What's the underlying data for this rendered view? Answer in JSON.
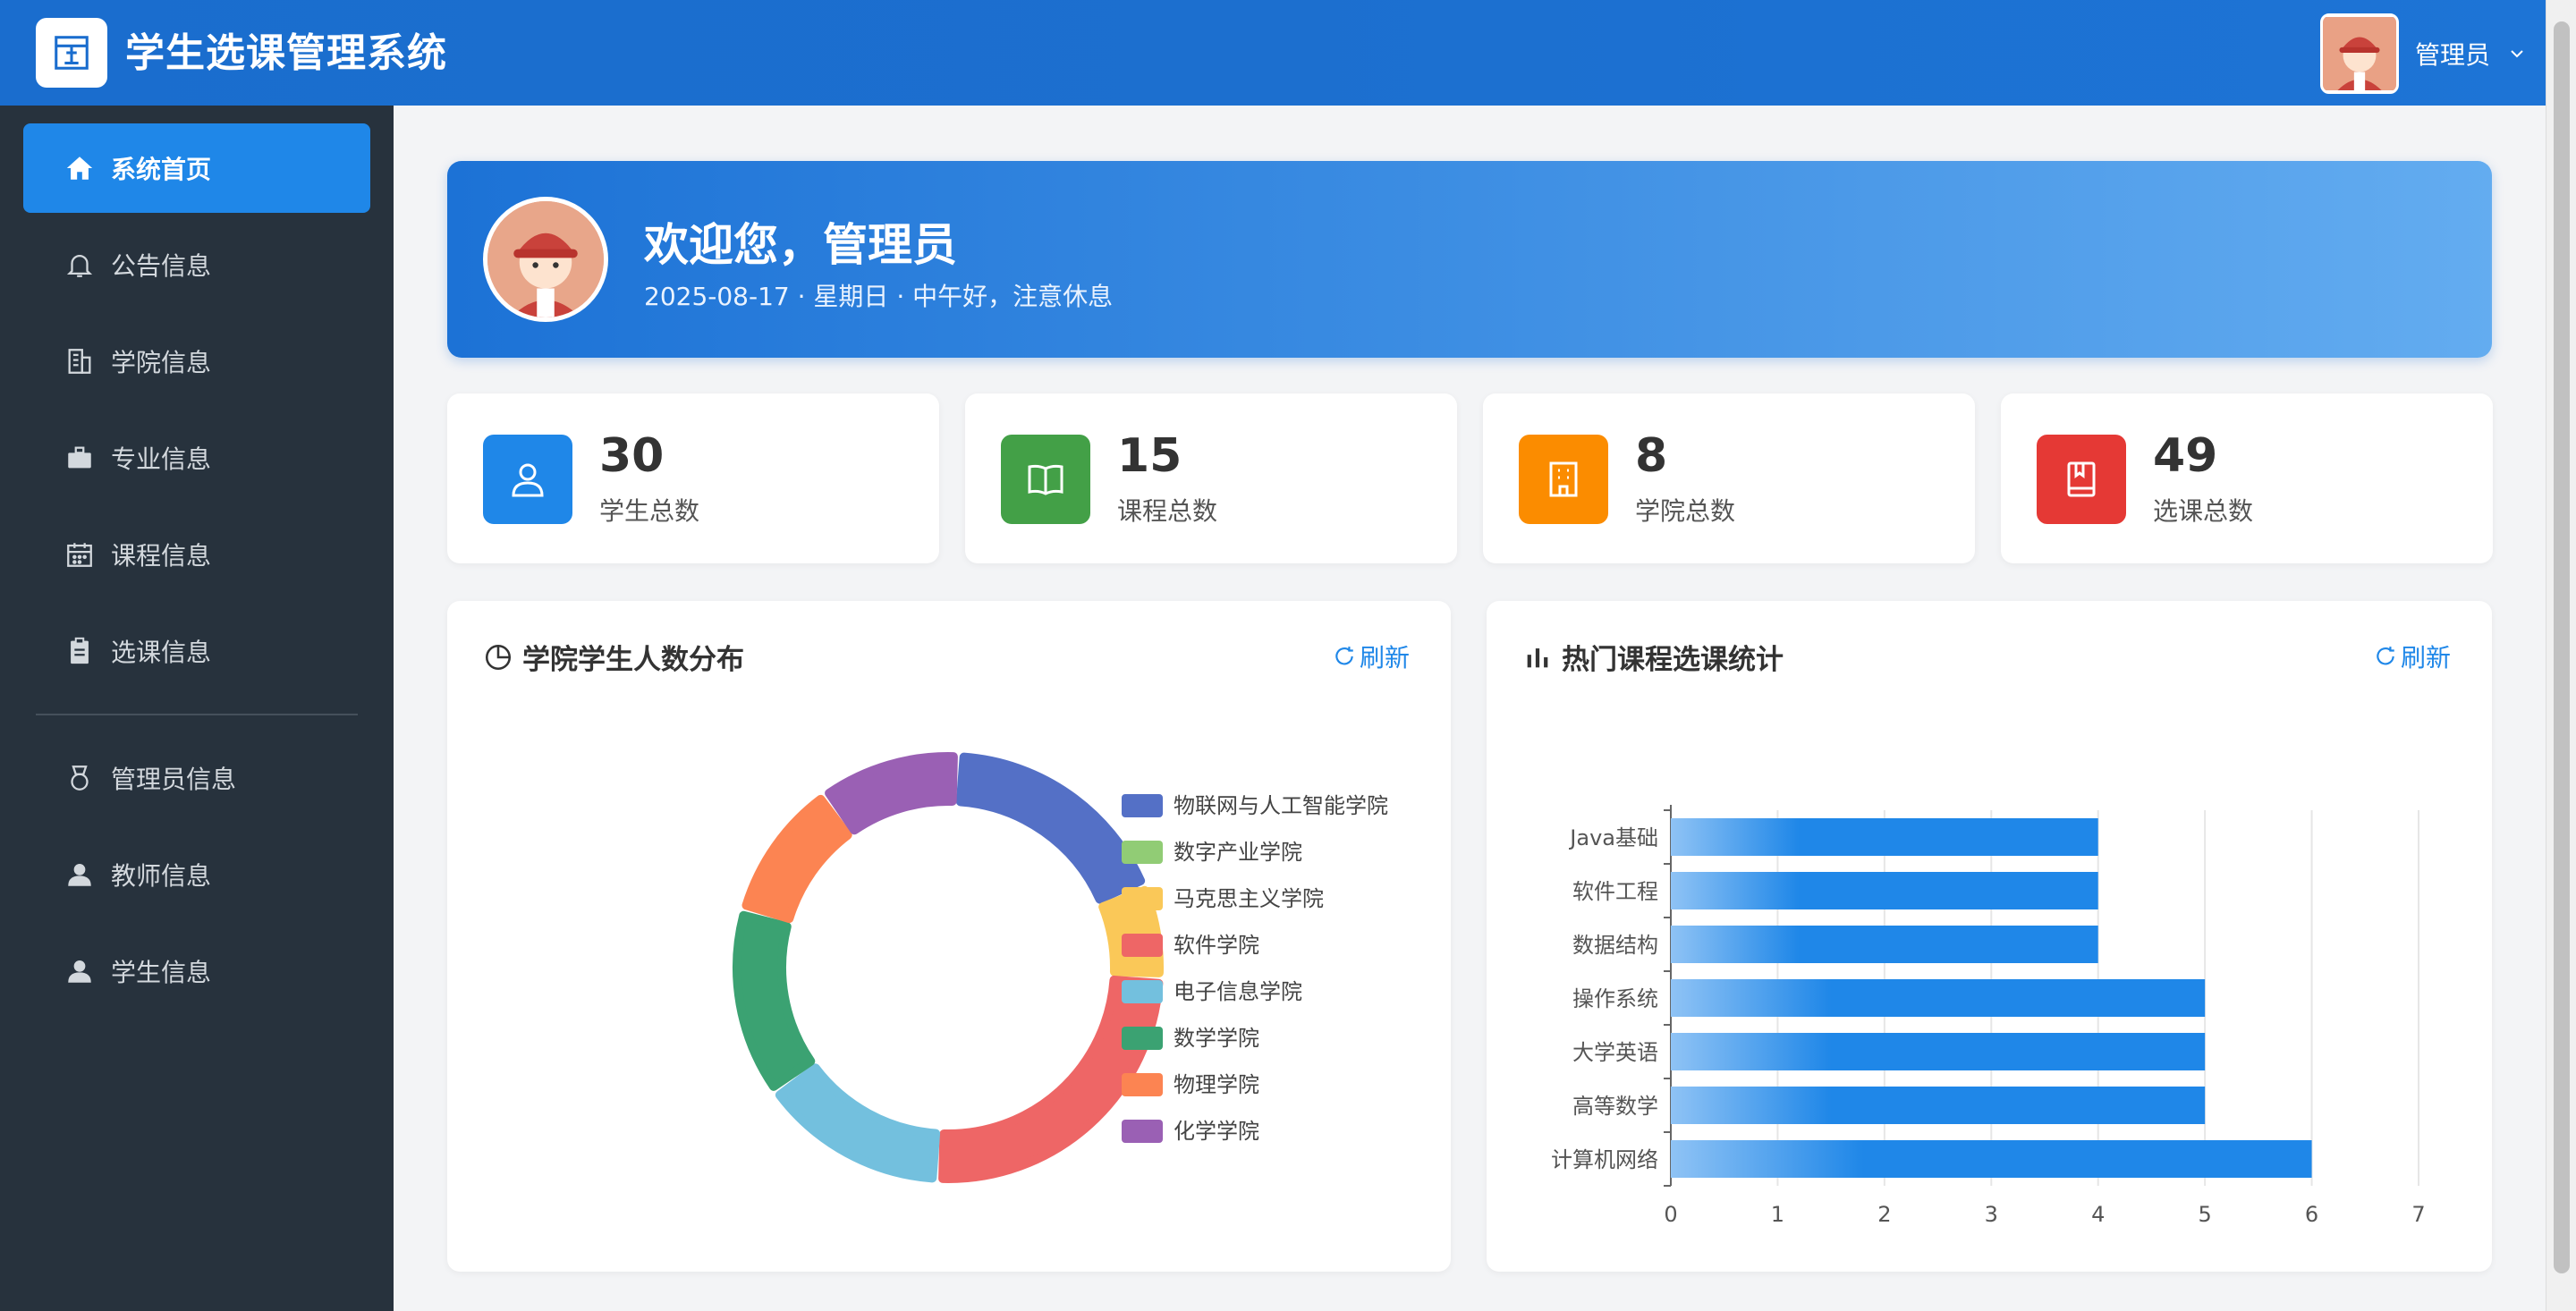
{
  "header": {
    "title": "学生选课管理系统",
    "user_name": "管理员",
    "logo_icon": "building-icon",
    "dropdown_icon": "chevron-down-icon"
  },
  "sidebar": {
    "items": [
      {
        "label": "系统首页",
        "icon": "home-icon",
        "active": true
      },
      {
        "label": "公告信息",
        "icon": "bell-icon"
      },
      {
        "label": "学院信息",
        "icon": "building-icon"
      },
      {
        "label": "专业信息",
        "icon": "briefcase-icon"
      },
      {
        "label": "课程信息",
        "icon": "calendar-icon"
      },
      {
        "label": "选课信息",
        "icon": "clipboard-icon"
      },
      {
        "label": "管理员信息",
        "icon": "medal-icon"
      },
      {
        "label": "教师信息",
        "icon": "user-icon"
      },
      {
        "label": "学生信息",
        "icon": "user-icon"
      }
    ]
  },
  "welcome": {
    "title": "欢迎您，管理员",
    "subtitle": "2025-08-17 · 星期日 · 中午好，注意休息"
  },
  "stats": [
    {
      "value": "30",
      "label": "学生总数",
      "color": "#1f87e8",
      "icon": "user-outline-icon"
    },
    {
      "value": "15",
      "label": "课程总数",
      "color": "#43a047",
      "icon": "book-open-icon"
    },
    {
      "value": "8",
      "label": "学院总数",
      "color": "#fb8c00",
      "icon": "building-icon"
    },
    {
      "value": "49",
      "label": "选课总数",
      "color": "#e53935",
      "icon": "bookmark-book-icon"
    }
  ],
  "panels": {
    "pie": {
      "title": "学院学生人数分布",
      "refresh": "刷新",
      "icon": "pie-chart-icon"
    },
    "bar": {
      "title": "热门课程选课统计",
      "refresh": "刷新",
      "icon": "bar-chart-icon"
    }
  },
  "chart_data": [
    {
      "type": "pie",
      "donut": true,
      "categories": [
        "物联网与人工智能学院",
        "数字产业学院",
        "马克思主义学院",
        "软件学院",
        "电子信息学院",
        "数学学院",
        "物理学院",
        "化学学院"
      ],
      "values": [
        5,
        0,
        2,
        7,
        4,
        4,
        3,
        3
      ],
      "colors": [
        "#5470c6",
        "#91cc75",
        "#fac858",
        "#ee6666",
        "#73c0de",
        "#3ba272",
        "#fc8452",
        "#9a60b4"
      ],
      "legend": "right"
    },
    {
      "type": "bar",
      "orientation": "horizontal",
      "categories": [
        "Java基础",
        "软件工程",
        "数据结构",
        "操作系统",
        "大学英语",
        "高等数学",
        "计算机网络"
      ],
      "values": [
        4,
        4,
        4,
        5,
        5,
        5,
        6
      ],
      "xlim": [
        0,
        7
      ],
      "xticks": [
        "0",
        "1",
        "2",
        "3",
        "4",
        "5",
        "6",
        "7"
      ],
      "color": "#1f87e8",
      "grid": true
    }
  ]
}
